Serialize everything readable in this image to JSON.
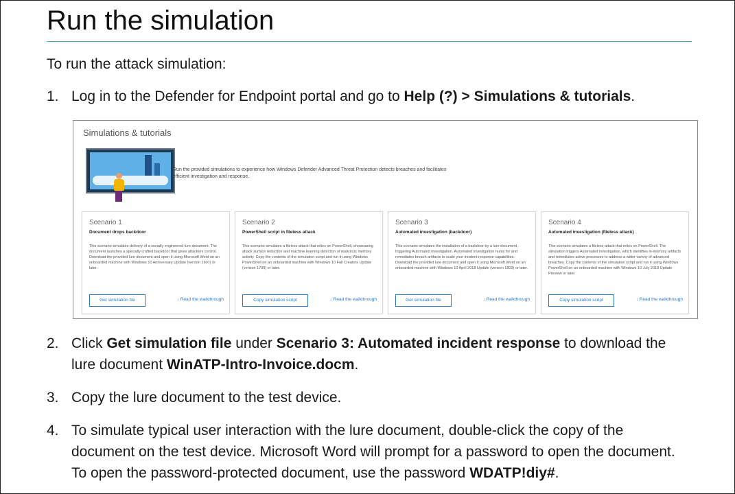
{
  "heading": "Run the simulation",
  "intro": "To run the attack simulation:",
  "steps": [
    {
      "num": "1.",
      "text_a": "Log in to the Defender for Endpoint portal and go to ",
      "bold_a": "Help (?) > Simulations & tutorials",
      "text_b": "."
    },
    {
      "num": "2.",
      "text_a": "Click ",
      "bold_a": "Get simulation file",
      "text_b": " under ",
      "bold_b": "Scenario 3: Automated incident response",
      "text_c": " to download the lure document ",
      "bold_c": "WinATP-Intro-Invoice.docm",
      "text_d": "."
    },
    {
      "num": "3.",
      "text_a": "Copy the lure document to the test device."
    },
    {
      "num": "4.",
      "text_a": "To simulate typical user interaction with the lure document, double-click the copy of the document on the test device. Microsoft Word will prompt for a password to open the document. To open the password-protected document, use the password ",
      "bold_a": "WDATP!diy#",
      "text_b": "."
    }
  ],
  "screenshot": {
    "title": "Simulations & tutorials",
    "hero_text": "Run the provided simulations to experience how Windows Defender Advanced Threat Protection detects breaches and facilitates efficient investigation and response.",
    "walkthrough_label": "Read the walkthrough",
    "walkthrough_icon": "download-arrow-icon",
    "cards": [
      {
        "scenario": "Scenario 1",
        "subtitle": "Document drops backdoor",
        "desc": "This scenario simulates delivery of a socially engineered lure document. The document launches a specially crafted backdoor that gives attackers control. Download the provided lure document and open it using Microsoft Word on an onboarded machine with Windows 10 Anniversary Update (version 1607) or later.",
        "button": "Get simulation file"
      },
      {
        "scenario": "Scenario 2",
        "subtitle": "PowerShell script in fileless attack",
        "desc": "This scenario simulates a fileless attack that relies on PowerShell, showcasing attack surface reduction and machine learning detection of malicious memory activity. Copy the contents of the simulation script and run it using Windows PowerShell on an onboarded machine with Windows 10 Fall Creators Update (version 1709) or later.",
        "button": "Copy simulation script"
      },
      {
        "scenario": "Scenario 3",
        "subtitle": "Automated investigation (backdoor)",
        "desc": "This scenario simulates the installation of a backdoor by a lure document, triggering Automated investigation. Automated investigation hunts for and remediates breach artifacts to scale your incident response capabilities. Download the provided lure document and open it using Microsoft Word on an onboarded machine with Windows 10 April 2018 Update (version 1803) or later.",
        "button": "Get simulation file"
      },
      {
        "scenario": "Scenario 4",
        "subtitle": "Automated investigation (fileless attack)",
        "desc": "This scenario simulates a fileless attack that relies on PowerShell. The simulation triggers Automated investigation, which identifies in-memory artifacts and remediates active processes to address a wider variety of advanced breaches. Copy the contents of the simulation script and run it using Windows PowerShell on an onboarded machine with Windows 10 July 2018 Update Preview or later.",
        "button": "Copy simulation script"
      }
    ]
  }
}
